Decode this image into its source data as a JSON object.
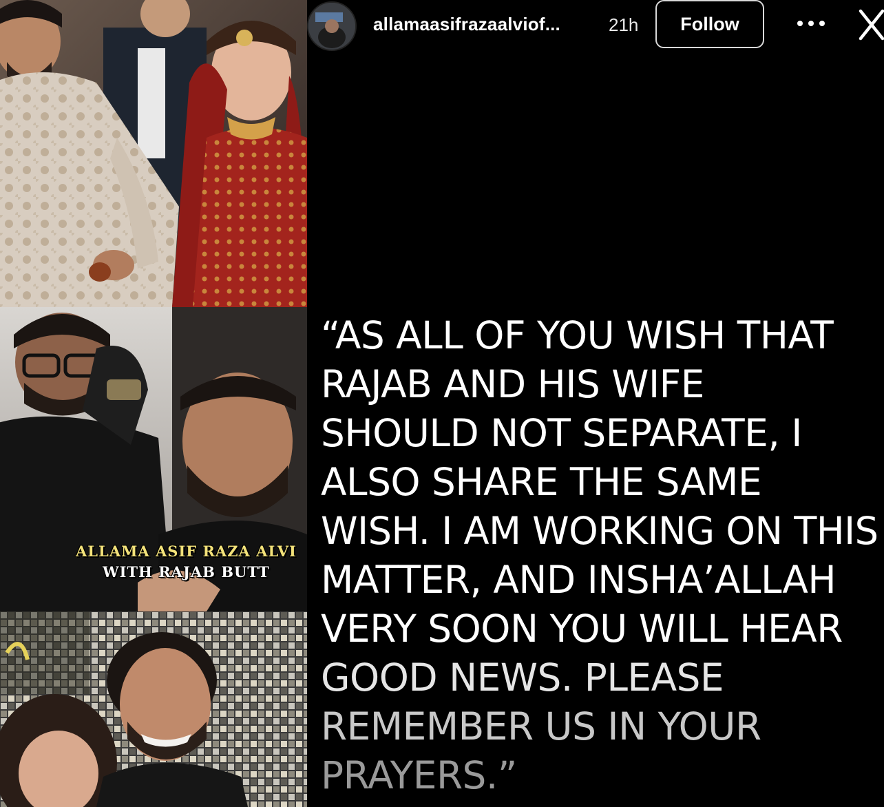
{
  "story": {
    "username": "allamaasifrazaalviof...",
    "time": "21h",
    "follow_label": "Follow",
    "more_icon": "more-horizontal-icon",
    "close_icon": "close-icon"
  },
  "collage": {
    "caption_line1": "ALLAMA ASIF RAZA ALVI",
    "caption_line2": "WITH RAJAB BUTT"
  },
  "quote": {
    "lines": [
      "“AS ALL OF YOU WISH THAT",
      "RAJAB AND HIS WIFE",
      "SHOULD NOT SEPARATE, I",
      "ALSO SHARE THE SAME",
      "WISH. I AM WORKING ON THIS",
      "MATTER, AND INSHA’ALLAH",
      "VERY SOON YOU WILL HEAR",
      "GOOD NEWS. PLEASE",
      "REMEMBER US IN YOUR",
      "PRAYERS.”"
    ]
  },
  "colors": {
    "background": "#000000",
    "text": "#ffffff",
    "bride_red": "#a0221d",
    "sherwani_cream": "#d9cfc4"
  }
}
